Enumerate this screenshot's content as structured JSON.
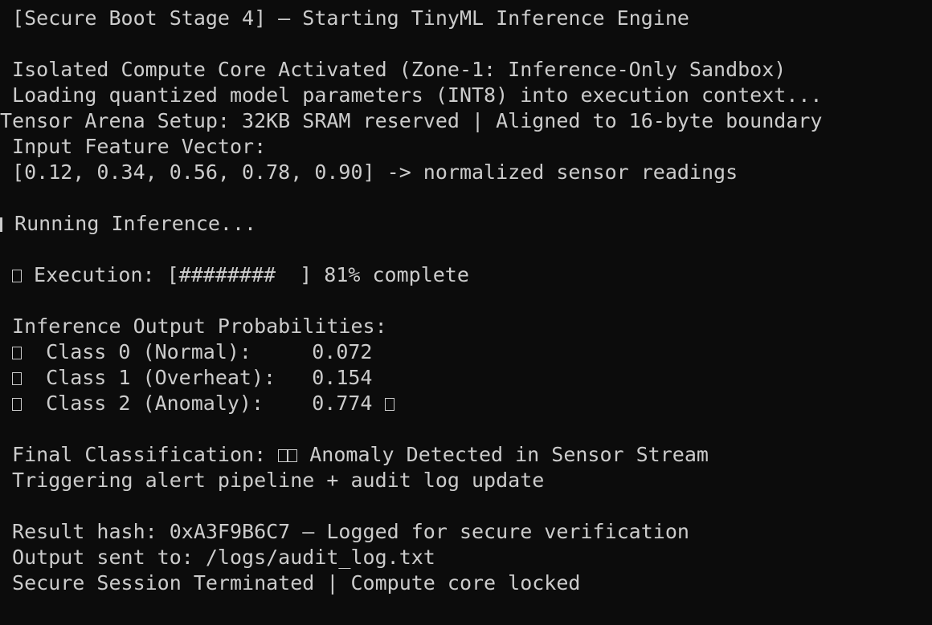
{
  "terminal": {
    "colors": {
      "background": "#0c0c0c",
      "foreground": "#cccccc"
    },
    "top_partial_line": "",
    "lines": [
      {
        "text": " [Secure Boot Stage 4] — Starting TinyML Inference Engine"
      },
      {
        "text": ""
      },
      {
        "text": " Isolated Compute Core Activated (Zone-1: Inference-Only Sandbox)"
      },
      {
        "text": " Loading quantized model parameters (INT8) into execution context..."
      },
      {
        "text": "Tensor Arena Setup: 32KB SRAM reserved | Aligned to 16-byte boundary"
      },
      {
        "text": " Input Feature Vector:"
      },
      {
        "text": " [0.12, 0.34, 0.56, 0.78, 0.90] -> normalized sensor readings"
      },
      {
        "text": ""
      },
      {
        "text": " Running Inference...",
        "prefix_icon": "cursor-sliver"
      },
      {
        "text": ""
      },
      {
        "text": " Execution: [########  ] 81% complete",
        "prefix_icon": "missing-glyph-icon"
      },
      {
        "text": ""
      },
      {
        "text": " Inference Output Probabilities:"
      },
      {
        "text": "  Class 0 (Normal):     0.072",
        "prefix_icon": "missing-glyph-icon"
      },
      {
        "text": "  Class 1 (Overheat):   0.154",
        "prefix_icon": "missing-glyph-icon"
      },
      {
        "text": "  Class 2 (Anomaly):    0.774",
        "prefix_icon": "missing-glyph-icon",
        "suffix_icon": "missing-glyph-icon"
      },
      {
        "text": ""
      },
      {
        "text": " Final Classification: ",
        "mid_icons": 2,
        "after": " Anomaly Detected in Sensor Stream"
      },
      {
        "text": " Triggering alert pipeline + audit log update"
      },
      {
        "text": ""
      },
      {
        "text": " Result hash: 0xA3F9B6C7 — Logged for secure verification"
      },
      {
        "text": " Output sent to: /logs/audit_log.txt"
      },
      {
        "text": " Secure Session Terminated | Compute core locked"
      }
    ]
  }
}
